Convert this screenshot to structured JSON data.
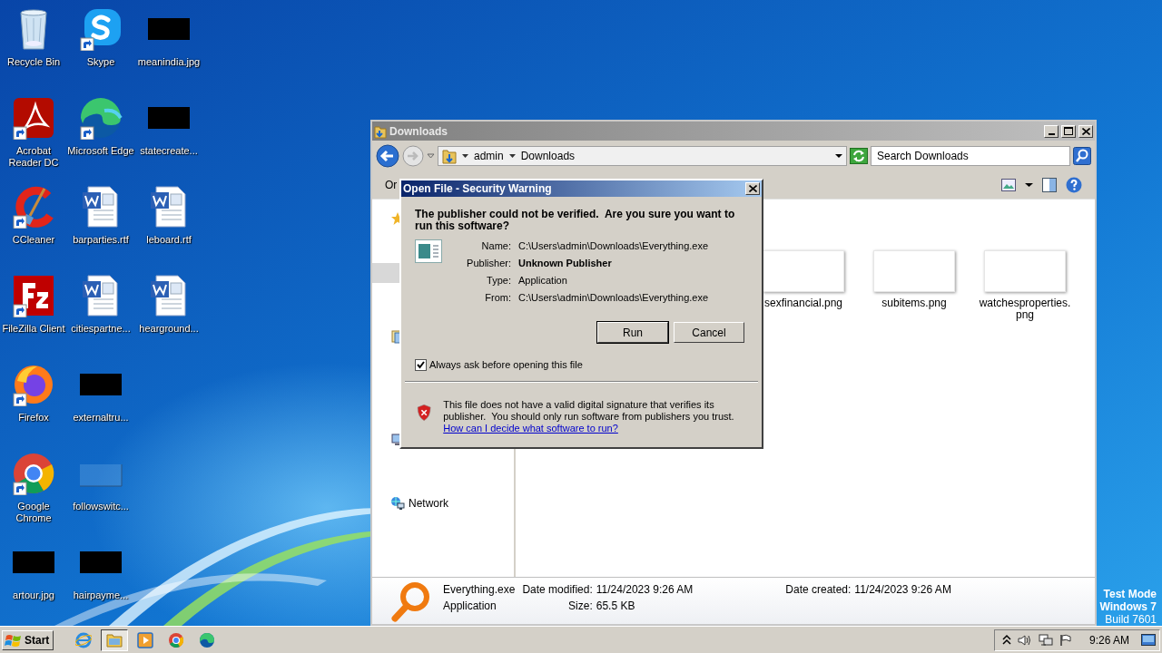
{
  "desktop": {
    "icons": [
      {
        "label": "Recycle Bin",
        "kind": "recycle-bin",
        "shortcut": false
      },
      {
        "label": "Acrobat Reader DC",
        "kind": "acrobat",
        "shortcut": true
      },
      {
        "label": "CCleaner",
        "kind": "ccleaner",
        "shortcut": true
      },
      {
        "label": "FileZilla Client",
        "kind": "filezilla",
        "shortcut": true
      },
      {
        "label": "Firefox",
        "kind": "firefox",
        "shortcut": true
      },
      {
        "label": "Google Chrome",
        "kind": "chrome",
        "shortcut": true
      },
      {
        "label": "artour.jpg",
        "kind": "redacted",
        "shortcut": false
      },
      {
        "label": "Skype",
        "kind": "skype",
        "shortcut": true
      },
      {
        "label": "Microsoft Edge",
        "kind": "edge",
        "shortcut": true
      },
      {
        "label": "barparties.rtf",
        "kind": "document",
        "shortcut": false
      },
      {
        "label": "citiespartne...",
        "kind": "document",
        "shortcut": false
      },
      {
        "label": "externaltru...",
        "kind": "redacted",
        "shortcut": false
      },
      {
        "label": "followswitc...",
        "kind": "blank",
        "shortcut": false
      },
      {
        "label": "hairpayme...",
        "kind": "redacted",
        "shortcut": false
      },
      {
        "label": "meanindia.jpg",
        "kind": "redacted",
        "shortcut": false
      },
      {
        "label": "statecreate...",
        "kind": "redacted",
        "shortcut": false
      },
      {
        "label": "leboard.rtf",
        "kind": "document",
        "shortcut": false
      },
      {
        "label": "hearground...",
        "kind": "document",
        "shortcut": false
      }
    ],
    "os_notice": [
      "Test Mode",
      "Windows 7",
      "Build 7601"
    ]
  },
  "explorer": {
    "title": "Downloads",
    "active": false,
    "breadcrumbs": [
      "admin",
      "Downloads"
    ],
    "search": {
      "placeholder": "Search Downloads"
    },
    "toolbar_label": "Or",
    "nav": [
      {
        "kind": "favorites",
        "selected": false
      },
      {
        "kind": "row",
        "selected": true
      },
      {
        "kind": "libraries",
        "selected": false
      },
      {
        "kind": "homegroup",
        "selected": false
      },
      {
        "kind": "network",
        "label": "Network",
        "selected": false
      }
    ],
    "files": [
      {
        "name": "sexfinancial.png"
      },
      {
        "name": "subitems.png"
      },
      {
        "name": "watchesproperties.png"
      }
    ],
    "details": {
      "name": "Everything.exe",
      "type": "Application",
      "fields": [
        {
          "label": "Date modified:",
          "value": "11/24/2023 9:26 AM"
        },
        {
          "label": "Size:",
          "value": "65.5 KB"
        },
        {
          "label": "Date created:",
          "value": "11/24/2023 9:26 AM"
        }
      ]
    }
  },
  "dialog": {
    "title": "Open File - Security Warning",
    "heading": "The publisher could not be verified.  Are you sure you want to run this software?",
    "fields": [
      {
        "label": "Name:",
        "value": "C:\\Users\\admin\\Downloads\\Everything.exe",
        "emphasis": false
      },
      {
        "label": "Publisher:",
        "value": "Unknown Publisher",
        "emphasis": true
      },
      {
        "label": "Type:",
        "value": "Application",
        "emphasis": false
      },
      {
        "label": "From:",
        "value": "C:\\Users\\admin\\Downloads\\Everything.exe",
        "emphasis": false
      }
    ],
    "buttons": [
      {
        "label": "Run",
        "default": true
      },
      {
        "label": "Cancel",
        "default": false
      }
    ],
    "checkbox": {
      "label": "Always ask before opening this file",
      "checked": true
    },
    "warning": {
      "text": "This file does not have a valid digital signature that verifies its publisher.  You should only run software from publishers you trust.",
      "link": "How can I decide what software to run?"
    }
  },
  "taskbar": {
    "start": "Start",
    "apps": [
      {
        "kind": "ie",
        "selected": false
      },
      {
        "kind": "explorer",
        "selected": true
      },
      {
        "kind": "media",
        "selected": false
      },
      {
        "kind": "chrome",
        "selected": false
      },
      {
        "kind": "edge",
        "selected": false
      }
    ],
    "tray": [
      {
        "kind": "chevron"
      },
      {
        "kind": "volume"
      },
      {
        "kind": "network"
      },
      {
        "kind": "flag"
      }
    ],
    "clock": "9:26 AM"
  }
}
